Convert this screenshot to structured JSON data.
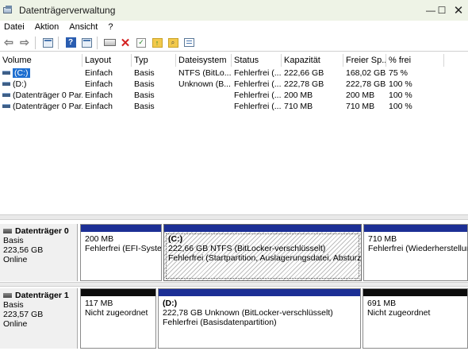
{
  "window": {
    "title": "Datenträgerverwaltung",
    "minimize_glyph": "—",
    "maximize_glyph": "☐",
    "close_glyph": "✕"
  },
  "menu": [
    "Datei",
    "Aktion",
    "Ansicht",
    "?"
  ],
  "toolbar": {
    "icons": [
      "back-arrow-icon",
      "forward-arrow-icon",
      "console-tree-icon",
      "help-icon",
      "properties-icon",
      "connect-disk-icon",
      "delete-icon",
      "check-icon",
      "folder-up-icon",
      "folder-search-icon",
      "settings-list-icon"
    ]
  },
  "table": {
    "columns": [
      "Volume",
      "Layout",
      "Typ",
      "Dateisystem",
      "Status",
      "Kapazität",
      "Freier Sp...",
      "% frei"
    ],
    "rows": [
      {
        "volume": "(C:)",
        "layout": "Einfach",
        "typ": "Basis",
        "dateisystem": "NTFS (BitLo...",
        "status": "Fehlerfrei (...",
        "kapazitaet": "222,66 GB",
        "frei": "168,02 GB",
        "prozent": "75 %"
      },
      {
        "volume": "(D:)",
        "layout": "Einfach",
        "typ": "Basis",
        "dateisystem": "Unknown (B...",
        "status": "Fehlerfrei (...",
        "kapazitaet": "222,78 GB",
        "frei": "222,78 GB",
        "prozent": "100 %"
      },
      {
        "volume": "(Datenträger 0 Par...",
        "layout": "Einfach",
        "typ": "Basis",
        "dateisystem": "",
        "status": "Fehlerfrei (...",
        "kapazitaet": "200 MB",
        "frei": "200 MB",
        "prozent": "100 %"
      },
      {
        "volume": "(Datenträger 0 Par...",
        "layout": "Einfach",
        "typ": "Basis",
        "dateisystem": "",
        "status": "Fehlerfrei (...",
        "kapazitaet": "710 MB",
        "frei": "710 MB",
        "prozent": "100 %"
      }
    ]
  },
  "disks": [
    {
      "name": "Datenträger 0",
      "type": "Basis",
      "size": "223,56 GB",
      "status": "Online",
      "partitions": [
        {
          "bar": "blue",
          "title": "",
          "line1": "200 MB",
          "line2": "Fehlerfrei (EFI-Systempartition)"
        },
        {
          "bar": "blue",
          "title": "(C:)",
          "line1": "222,66 GB NTFS (BitLocker-verschlüsselt)",
          "line2": "Fehlerfrei (Startpartition, Auslagerungsdatei, Absturzabbild)"
        },
        {
          "bar": "blue",
          "title": "",
          "line1": "710 MB",
          "line2": "Fehlerfrei (Wiederherstellungspartition)"
        }
      ]
    },
    {
      "name": "Datenträger 1",
      "type": "Basis",
      "size": "223,57 GB",
      "status": "Online",
      "partitions": [
        {
          "bar": "black",
          "title": "",
          "line1": "117 MB",
          "line2": "Nicht zugeordnet"
        },
        {
          "bar": "blue",
          "title": "(D:)",
          "line1": "222,78 GB Unknown (BitLocker-verschlüsselt)",
          "line2": "Fehlerfrei (Basisdatenpartition)"
        },
        {
          "bar": "black",
          "title": "",
          "line1": "691 MB",
          "line2": "Nicht zugeordnet"
        }
      ]
    }
  ],
  "colors": {
    "titlebar": "#eef3e6",
    "primary_partition": "#1c2f95",
    "unallocated": "#0c0c0c",
    "selected": "#1f6fd0"
  }
}
